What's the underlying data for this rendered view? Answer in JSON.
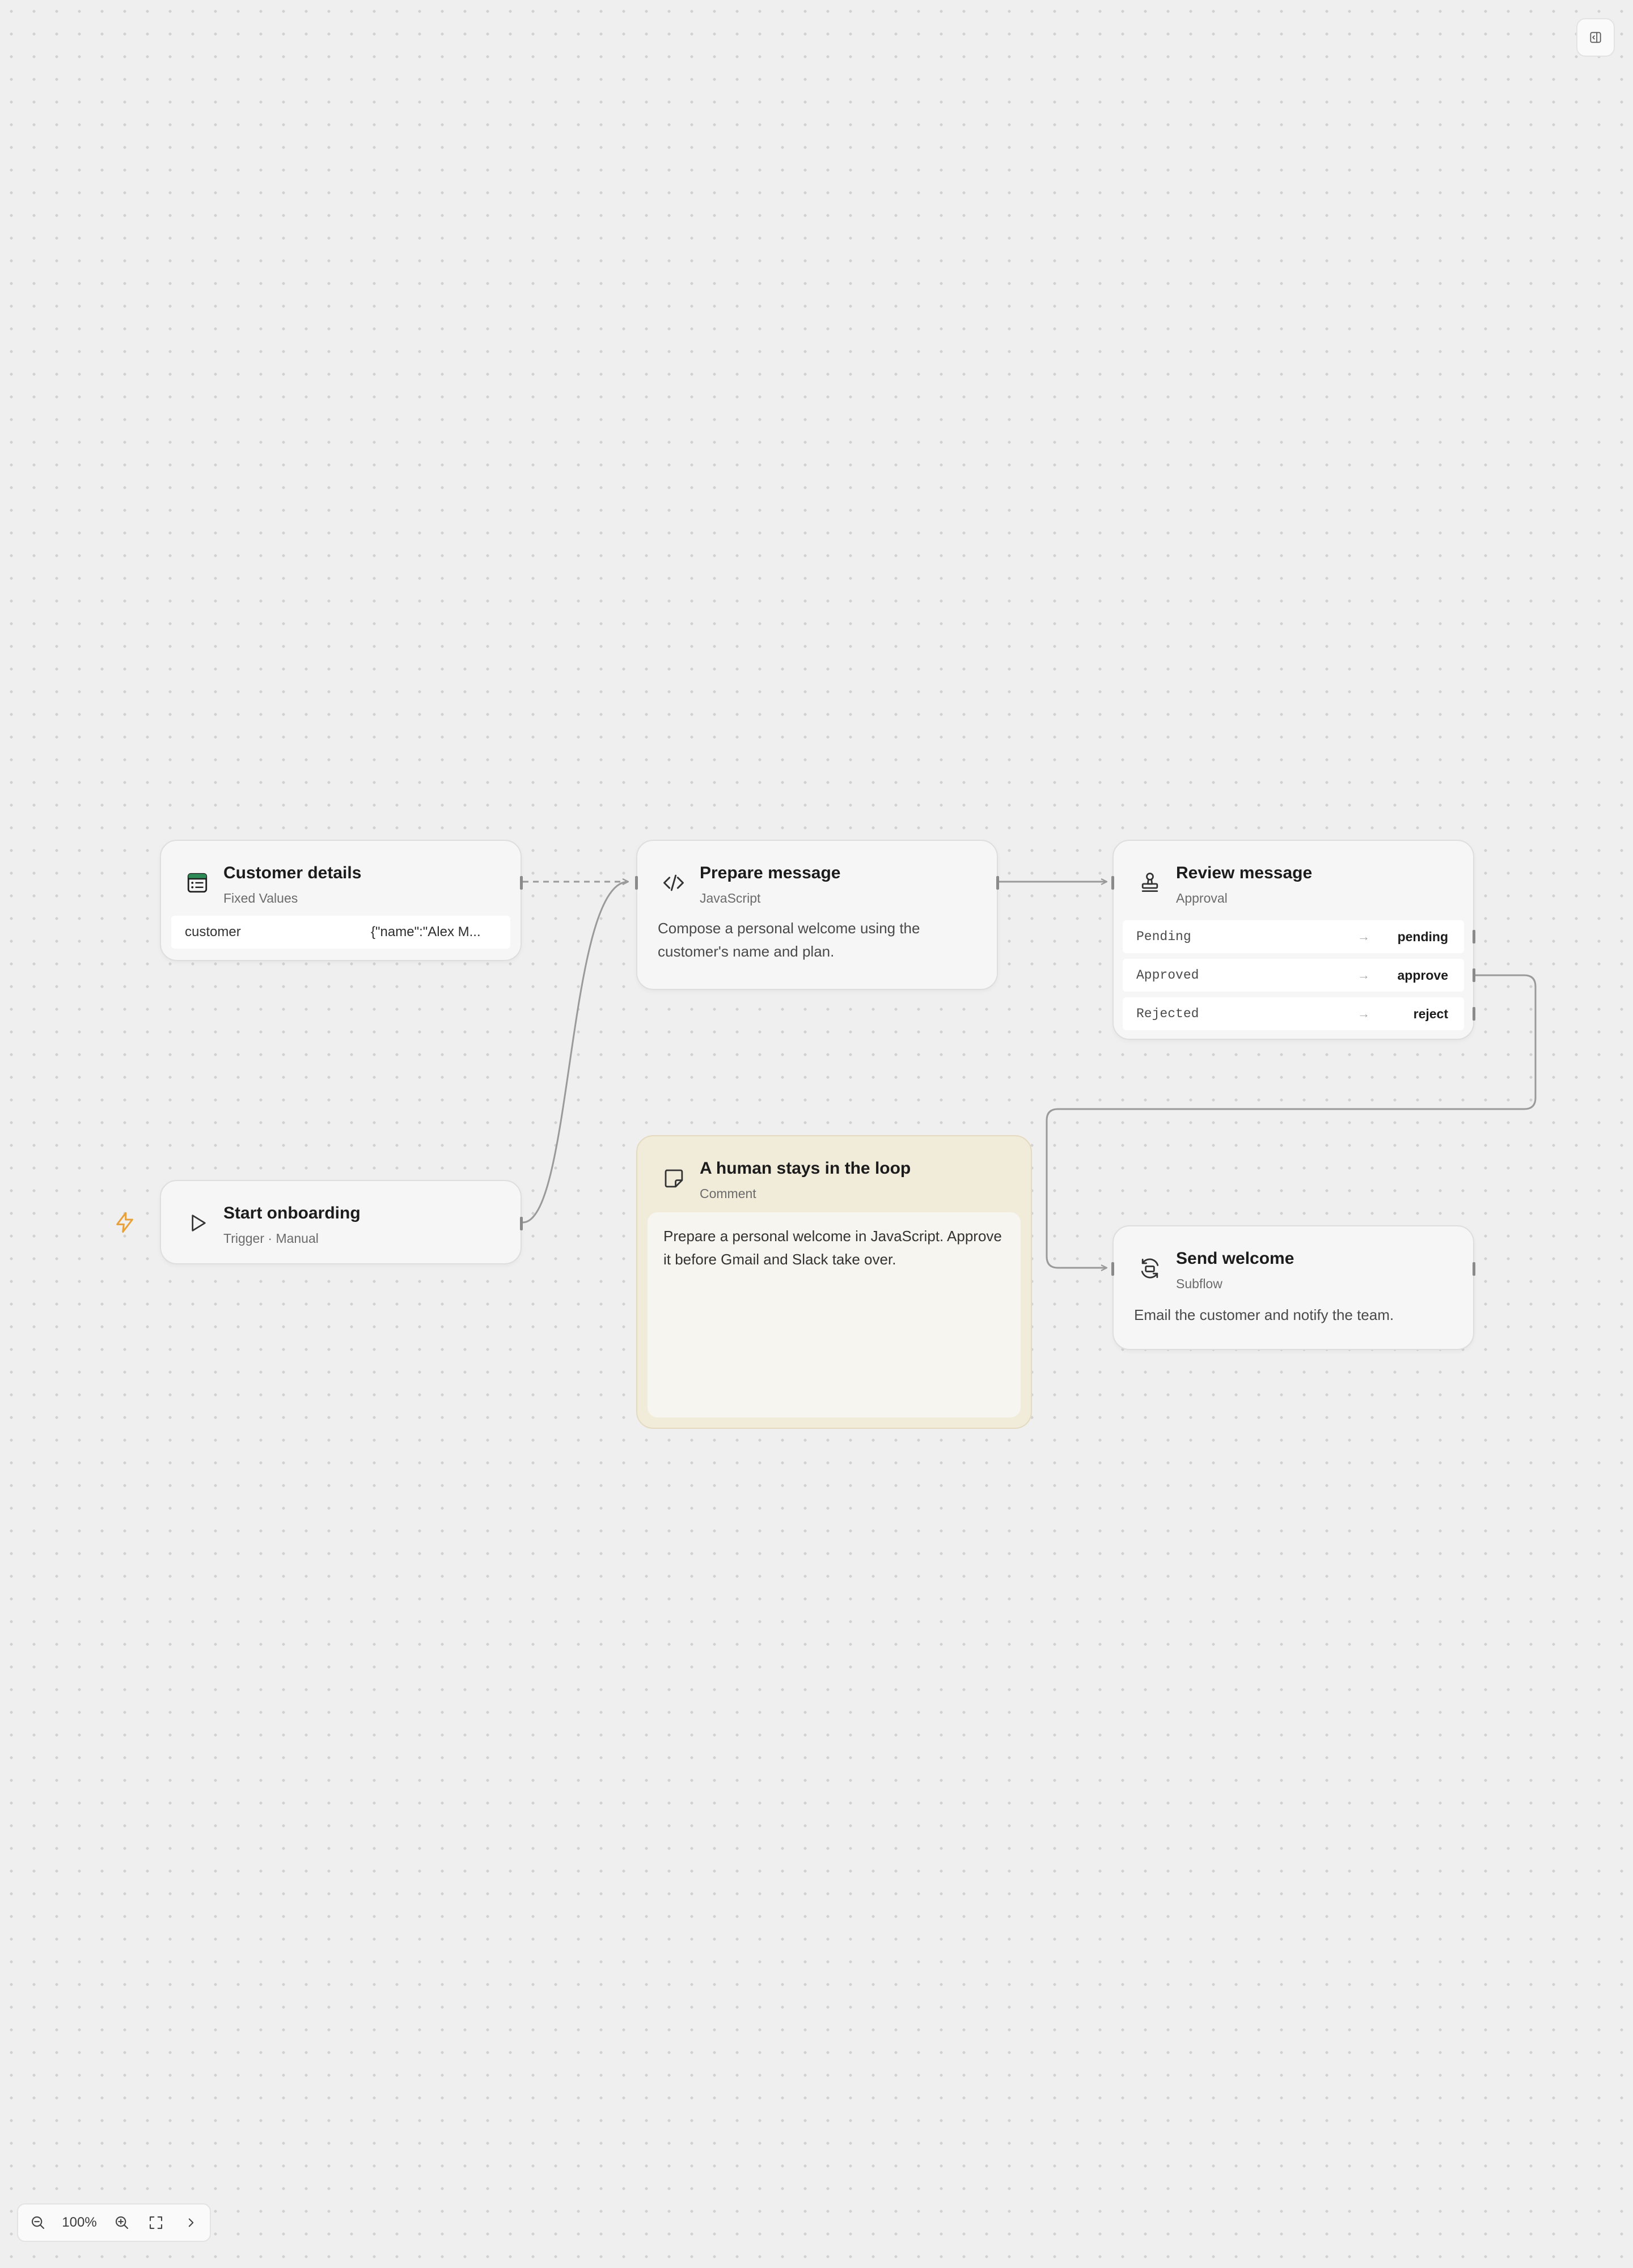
{
  "nodes": {
    "customer_details": {
      "title": "Customer details",
      "subtitle": "Fixed Values",
      "row": {
        "key": "customer",
        "value": "{\"name\":\"Alex M..."
      }
    },
    "prepare_message": {
      "title": "Prepare message",
      "subtitle": "JavaScript",
      "description": "Compose a personal welcome using the customer's name and plan."
    },
    "review_message": {
      "title": "Review message",
      "subtitle": "Approval",
      "branches": [
        {
          "label": "Pending",
          "value": "pending"
        },
        {
          "label": "Approved",
          "value": "approve"
        },
        {
          "label": "Rejected",
          "value": "reject"
        }
      ]
    },
    "start_onboarding": {
      "title": "Start onboarding",
      "subtitle": "Trigger · Manual"
    },
    "comment": {
      "title": "A human stays in the loop",
      "subtitle": "Comment",
      "text": "Prepare a personal welcome in JavaScript. Approve it before Gmail and Slack take over."
    },
    "send_welcome": {
      "title": "Send welcome",
      "subtitle": "Subflow",
      "description": "Email the customer and notify the team."
    }
  },
  "toolbar": {
    "zoom_level": "100%"
  },
  "colors": {
    "canvas_bg": "#efefef",
    "node_bg": "#f6f6f6",
    "comment_bg": "#f1ebda",
    "edge": "#9a9a9a",
    "trigger_accent": "#e8a13a",
    "table_icon_green": "#2e8b57"
  }
}
